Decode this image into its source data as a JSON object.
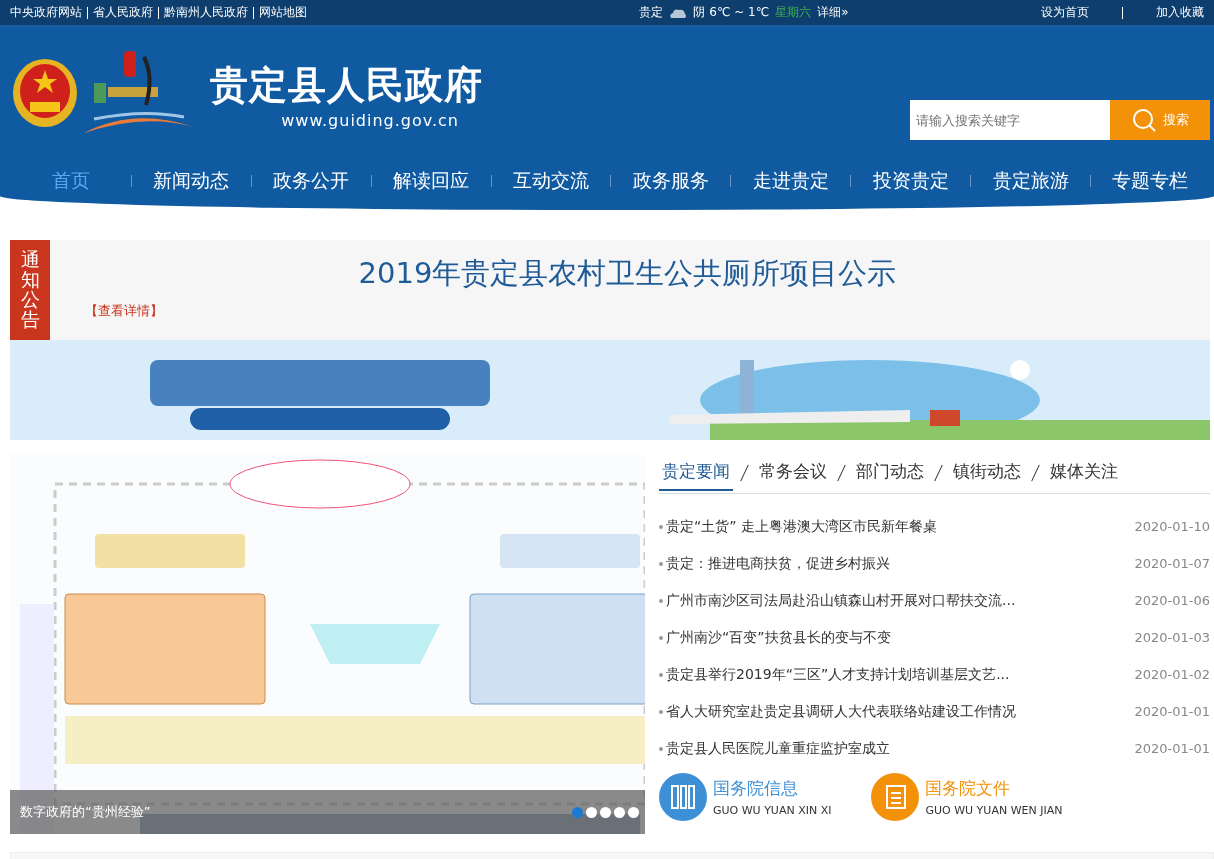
{
  "topbar": {
    "links": [
      "中央政府网站",
      "省人民政府",
      "黔南州人民政府",
      "网站地图"
    ],
    "weather": {
      "city": "贵定",
      "condition": "阴 6℃ ~ 1℃",
      "weekday": "星期六",
      "more": "详细»"
    },
    "actions": [
      "设为首页",
      "加入收藏"
    ]
  },
  "header": {
    "site_name": "贵定县人民政府",
    "url": "www.guiding.gov.cn",
    "search": {
      "placeholder": "请输入搜索关键字",
      "button": "搜索"
    }
  },
  "nav": [
    {
      "label": "首页",
      "selected": true
    },
    {
      "label": "新闻动态",
      "selected": false
    },
    {
      "label": "政务公开",
      "selected": false
    },
    {
      "label": "解读回应",
      "selected": false
    },
    {
      "label": "互动交流",
      "selected": false
    },
    {
      "label": "政务服务",
      "selected": false
    },
    {
      "label": "走进贵定",
      "selected": false
    },
    {
      "label": "投资贵定",
      "selected": false
    },
    {
      "label": "贵定旅游",
      "selected": false
    },
    {
      "label": "专题专栏",
      "selected": false
    }
  ],
  "notice": {
    "tag": "通知公告",
    "title": "2019年贵定县农村卫生公共厕所项目公示",
    "more": "【查看详情】"
  },
  "carousel": {
    "caption": "数字政府的“贵州经验”",
    "dots": [
      {
        "selected": true
      },
      {
        "selected": false
      },
      {
        "selected": false
      },
      {
        "selected": false
      },
      {
        "selected": false
      }
    ]
  },
  "news": {
    "tabs": [
      {
        "label": "贵定要闻",
        "selected": true
      },
      {
        "label": "常务会议",
        "selected": false
      },
      {
        "label": "部门动态",
        "selected": false
      },
      {
        "label": "镇街动态",
        "selected": false
      },
      {
        "label": "媒体关注",
        "selected": false
      }
    ],
    "items": [
      {
        "title": "贵定“土货” 走上粤港澳大湾区市民新年餐桌",
        "date": "2020-01-10"
      },
      {
        "title": "贵定：推进电商扶贫，促进乡村振兴",
        "date": "2020-01-07"
      },
      {
        "title": "广州市南沙区司法局赴沿山镇森山村开展对口帮扶交流...",
        "date": "2020-01-06"
      },
      {
        "title": "广州南沙“百变”扶贫县长的变与不变",
        "date": "2020-01-03"
      },
      {
        "title": "贵定县举行2019年“三区”人才支持计划培训基层文艺...",
        "date": "2020-01-02"
      },
      {
        "title": "省人大研究室赴贵定县调研人大代表联络站建设工作情况",
        "date": "2020-01-01"
      },
      {
        "title": "贵定县人民医院儿童重症监护室成立",
        "date": "2020-01-01"
      }
    ]
  },
  "quick_links": [
    {
      "kind": "info",
      "title": "国务院信息",
      "pinyin": "GUO WU YUAN XIN XI",
      "color": "#3d8fd6"
    },
    {
      "kind": "docs",
      "title": "国务院文件",
      "pinyin": "GUO WU YUAN WEN JIAN",
      "color": "#f39209"
    }
  ]
}
